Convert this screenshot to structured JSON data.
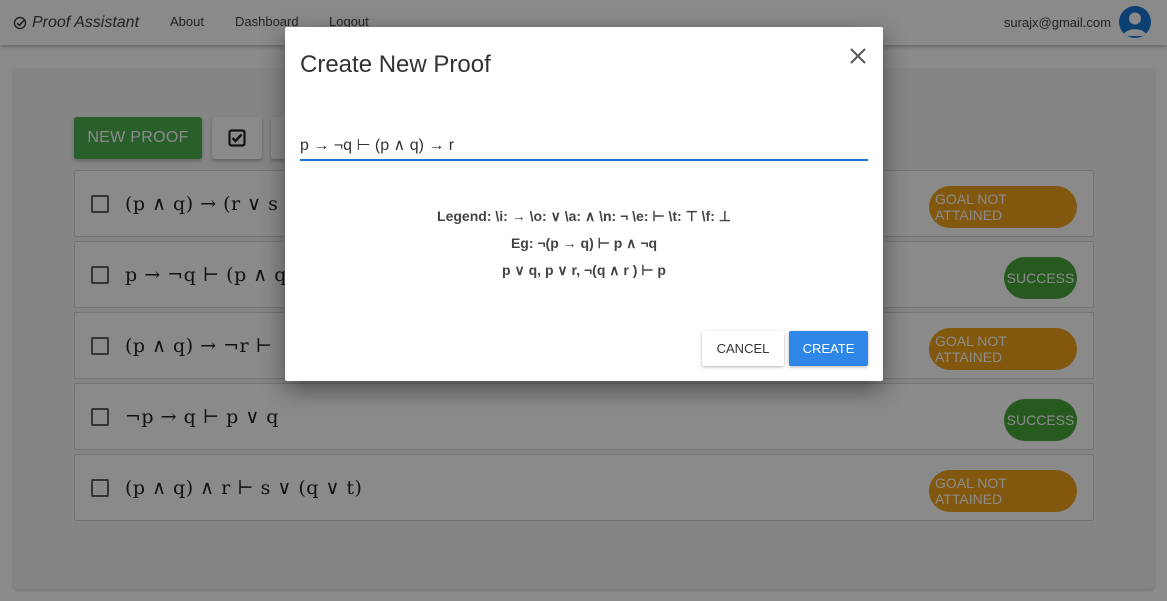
{
  "appbar": {
    "brand": "Proof Assistant",
    "nav": [
      "About",
      "Dashboard",
      "Logout"
    ],
    "user_email": "surajx@gmail.com"
  },
  "toolbar": {
    "new_proof_label": "NEW PROOF"
  },
  "proofs": [
    {
      "formula": "(p ∧ q) → (r ∨ s",
      "status": "GOAL NOT ATTAINED",
      "status_kind": "warn"
    },
    {
      "formula": "p → ¬q ⊢ (p ∧ q",
      "status": "SUCCESS",
      "status_kind": "ok"
    },
    {
      "formula": "(p ∧ q) → ¬r ⊢",
      "status": "GOAL NOT ATTAINED",
      "status_kind": "warn"
    },
    {
      "formula": "¬p → q ⊢ p ∨ q",
      "status": "SUCCESS",
      "status_kind": "ok"
    },
    {
      "formula": "(p ∧ q) ∧ r ⊢ s ∨ (q ∨ t)",
      "status": "GOAL NOT ATTAINED",
      "status_kind": "warn"
    }
  ],
  "dialog": {
    "title": "Create New Proof",
    "input_value": "p → ¬q ⊢ (p ∧ q) → r",
    "legend_line": "Legend:  \\i: →   \\o: ∨   \\a: ∧   \\n: ¬   \\e: ⊢   \\t: ⊤   \\f: ⊥",
    "example_line": "Eg:  ¬(p → q)  ⊢  p ∧ ¬q",
    "example_line2": "p ∨ q, p ∨ r, ¬(q ∧ r )  ⊢  p",
    "cancel_label": "CANCEL",
    "create_label": "CREATE"
  },
  "colors": {
    "primary": "#1976d2",
    "success": "#46a73a",
    "warning": "#f0a31c",
    "new_proof": "#4caf50"
  }
}
